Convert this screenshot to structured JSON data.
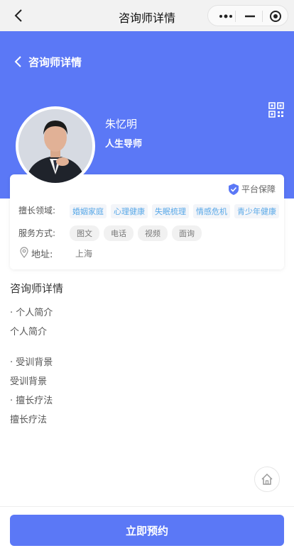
{
  "window": {
    "title": "咨询师详情",
    "back_icon": "chevron-left-icon",
    "capsule_icons": [
      "more-dots-icon",
      "minus-icon",
      "target-icon"
    ]
  },
  "header": {
    "subtitle": "咨询师详情",
    "name": "朱忆明",
    "role": "人生导师",
    "qr_icon": "qr-code-icon",
    "background": "#5b78f6"
  },
  "card": {
    "guarantee": "平台保障",
    "field_label": "擅长领域:",
    "fields": [
      "婚姻家庭",
      "心理健康",
      "失眠梳理",
      "情感危机",
      "青少年健康"
    ],
    "service_label": "服务方式:",
    "services": [
      "图文",
      "电话",
      "视频",
      "面询"
    ],
    "address_label": "地址:",
    "address": "上海"
  },
  "details": {
    "title": "咨询师详情",
    "intro_heading": "· 个人简介",
    "intro_text": "个人简介",
    "training_heading": "· 受训背景",
    "training_text": "受训背景",
    "therapy_heading": "· 擅长疗法",
    "therapy_text": "擅长疗法"
  },
  "footer": {
    "home_icon": "home-icon",
    "book_label": "立即预约",
    "accent": "#5b78f6"
  }
}
